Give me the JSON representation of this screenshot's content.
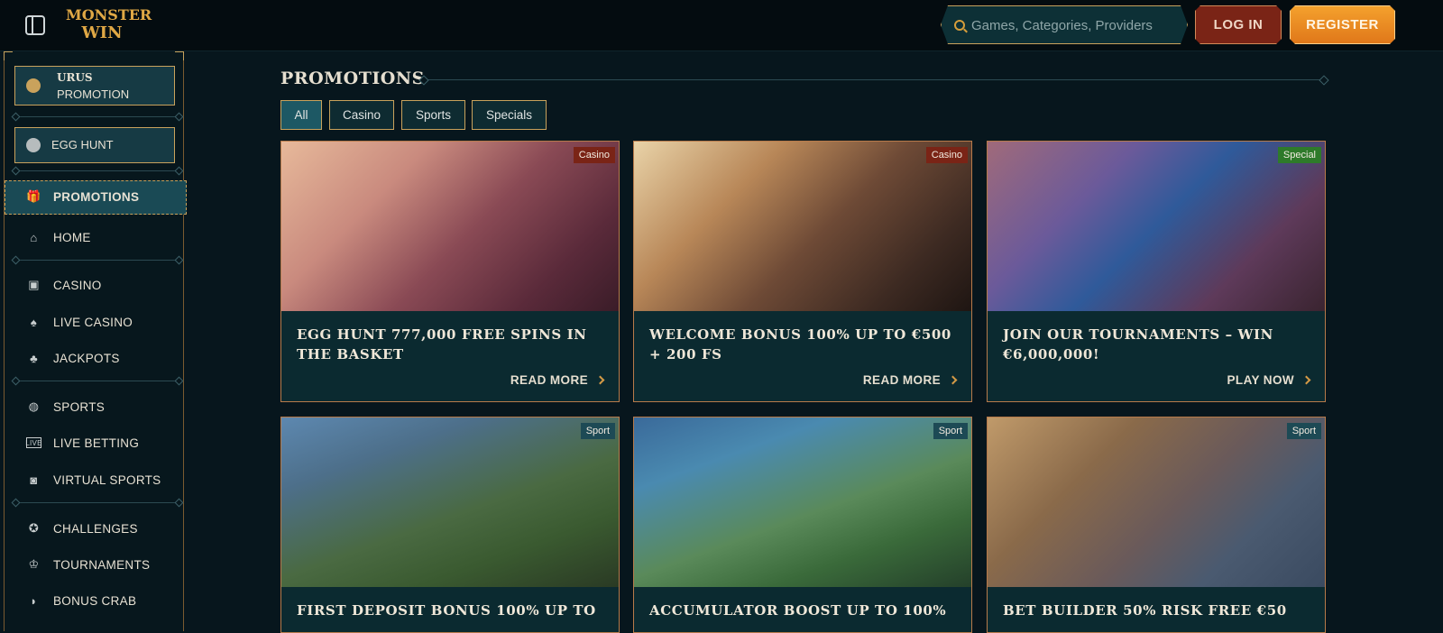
{
  "header": {
    "logo_line1": "MONSTER",
    "logo_line2": "WIN",
    "search_placeholder": "Games, Categories, Providers",
    "login_label": "LOG IN",
    "register_label": "REGISTER"
  },
  "sidebar": {
    "promo1_title": "URUS",
    "promo1_sub": "PROMOTION",
    "promo2_label": "EGG HUNT",
    "items": [
      {
        "label": "PROMOTIONS",
        "icon": "gift-icon",
        "active": true
      },
      {
        "label": "HOME",
        "icon": "home-icon"
      },
      {
        "label": "CASINO",
        "icon": "slot-machine-icon"
      },
      {
        "label": "LIVE CASINO",
        "icon": "cards-icon"
      },
      {
        "label": "JACKPOTS",
        "icon": "clover-icon"
      },
      {
        "label": "SPORTS",
        "icon": "basketball-icon"
      },
      {
        "label": "LIVE BETTING",
        "icon": "live-icon"
      },
      {
        "label": "VIRTUAL SPORTS",
        "icon": "virtual-sports-icon"
      },
      {
        "label": "CHALLENGES",
        "icon": "medal-icon"
      },
      {
        "label": "TOURNAMENTS",
        "icon": "trophy-icon"
      },
      {
        "label": "BONUS CRAB",
        "icon": "crab-icon"
      }
    ]
  },
  "main": {
    "title": "PROMOTIONS",
    "filters": [
      "All",
      "Casino",
      "Sports",
      "Specials"
    ],
    "active_filter": "All",
    "cards": [
      {
        "badge": "Casino",
        "title": "EGG HUNT 777,000 FREE SPINS IN THE BASKET",
        "cta": "READ MORE"
      },
      {
        "badge": "Casino",
        "title": "WELCOME BONUS 100% UP TO €500 + 200 FS",
        "cta": "READ MORE"
      },
      {
        "badge": "Special",
        "title": "JOIN OUR TOURNAMENTS – WIN €6,000,000!",
        "cta": "PLAY NOW"
      },
      {
        "badge": "Sport",
        "title": "FIRST DEPOSIT BONUS 100% UP TO",
        "cta": ""
      },
      {
        "badge": "Sport",
        "title": "ACCUMULATOR BOOST UP TO 100%",
        "cta": ""
      },
      {
        "badge": "Sport",
        "title": "BET BUILDER 50% RISK FREE €50",
        "cta": ""
      }
    ]
  },
  "colors": {
    "accent_gold": "#c9a25c",
    "register_orange": "#f0901f",
    "login_red": "#7a2416",
    "badge_casino": "#7a2416",
    "badge_special": "#2e7a2a",
    "badge_sport": "#1d4a55"
  }
}
